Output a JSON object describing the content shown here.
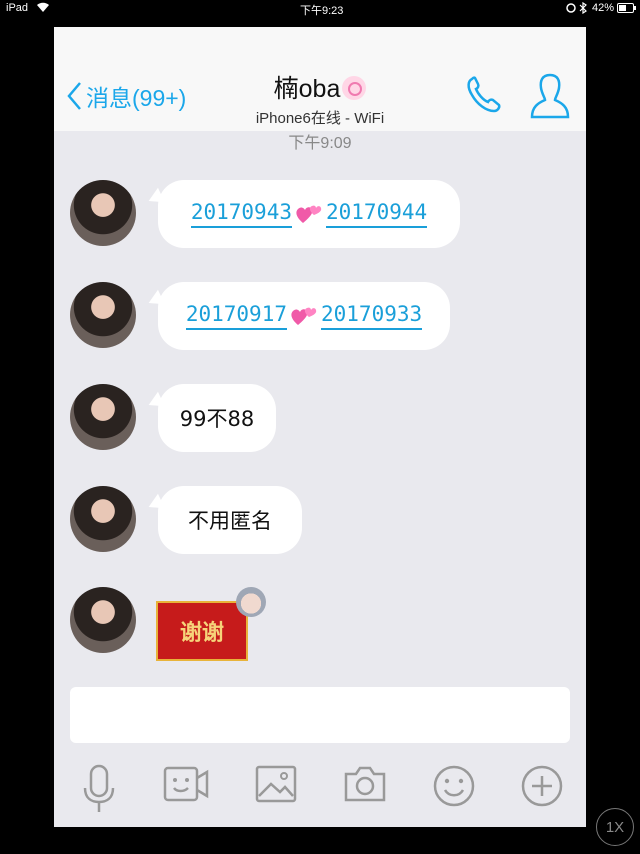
{
  "status_bar": {
    "device": "iPad",
    "time": "下午9:23",
    "battery": "42%"
  },
  "header": {
    "back_label": "消息(99+)",
    "title": "楠oba",
    "subtitle": "iPhone6在线 - WiFi"
  },
  "timestamp": "下午9:09",
  "messages": [
    {
      "type": "links",
      "left": "20170943",
      "right": "20170944"
    },
    {
      "type": "links",
      "left": "20170917",
      "right": "20170933"
    },
    {
      "type": "text",
      "text": "99不88"
    },
    {
      "type": "text",
      "text": "不用匿名"
    },
    {
      "type": "sticker",
      "text": "谢谢"
    }
  ],
  "toolbar": {
    "icons": [
      "microphone-icon",
      "video-icon",
      "image-icon",
      "camera-icon",
      "emoji-icon",
      "plus-icon"
    ]
  },
  "zoom_label": "1X",
  "colors": {
    "accent": "#1ba7ea",
    "background": "#e9e9ee",
    "bubble": "#ffffff"
  }
}
